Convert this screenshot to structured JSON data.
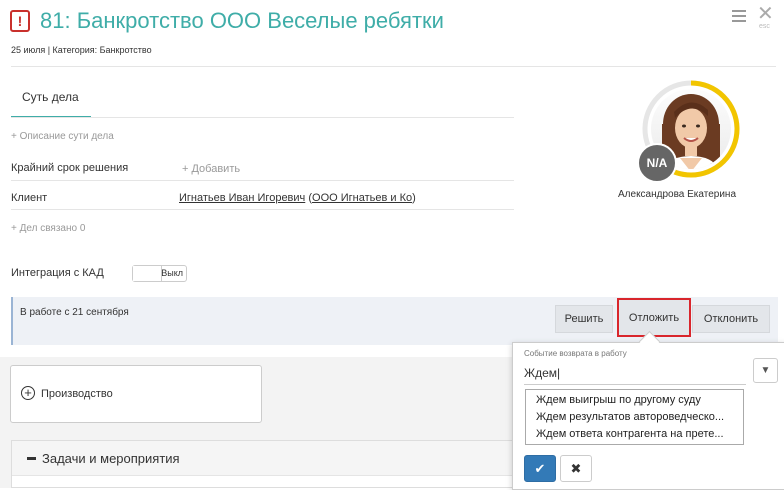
{
  "header": {
    "badge": "!",
    "title": "81: Банкротство ООО Веселые ребятки",
    "meta": "25 июля | Категория: Банкротство",
    "esc_label": "esc"
  },
  "tabs": [
    {
      "label": "Суть дела"
    }
  ],
  "details": {
    "description_link": "+ Описание сути дела",
    "deadline_label": "Крайний срок решения",
    "deadline_add": "+ Добавить",
    "client_label": "Клиент",
    "client_person": "Игнатьев Иван Игоревич",
    "client_company": "ООО Игнатьев и Ко",
    "related_link": "+ Дел связано 0",
    "kad_label": "Интеграция с КАД",
    "kad_toggle": "Выкл"
  },
  "assignee": {
    "name": "Александрова Екатерина",
    "badge": "N/A",
    "progress": 0.6,
    "ring_color": "#f2c500"
  },
  "status": {
    "text": "В работе с 21 сентября",
    "buttons": [
      "Решить",
      "Отложить",
      "Отклонить"
    ]
  },
  "production": {
    "label": "Производство"
  },
  "tasks": {
    "label": "Задачи и мероприятия"
  },
  "popup": {
    "label": "Событие возврата в работу",
    "input_value": "Ждем",
    "options": [
      "Ждем выигрыш по другому суду",
      "Ждем результатов автороведческо...",
      "Ждем ответа контрагента на прете..."
    ],
    "confirm_icon": "check-icon",
    "cancel_icon": "x-icon"
  },
  "colors": {
    "accent": "#3fada8",
    "highlight": "#d9262c",
    "primary": "#337ab7"
  }
}
